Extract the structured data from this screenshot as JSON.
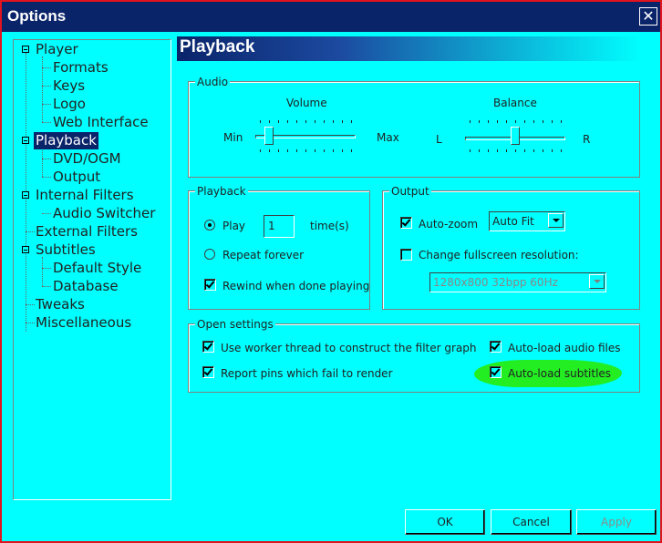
{
  "window": {
    "title": "Options",
    "close_glyph": "✕"
  },
  "tree": {
    "items": [
      {
        "label": "Player"
      },
      {
        "label": "Formats"
      },
      {
        "label": "Keys"
      },
      {
        "label": "Logo"
      },
      {
        "label": "Web Interface"
      },
      {
        "label": "Playback"
      },
      {
        "label": "DVD/OGM"
      },
      {
        "label": "Output"
      },
      {
        "label": "Internal Filters"
      },
      {
        "label": "Audio Switcher"
      },
      {
        "label": "External Filters"
      },
      {
        "label": "Subtitles"
      },
      {
        "label": "Default Style"
      },
      {
        "label": "Database"
      },
      {
        "label": "Tweaks"
      },
      {
        "label": "Miscellaneous"
      }
    ],
    "selected": "Playback"
  },
  "page": {
    "title": "Playback"
  },
  "audio": {
    "group_label": "Audio",
    "volume_label": "Volume",
    "volume_min": "Min",
    "volume_max": "Max",
    "volume_level_fraction": 0.1,
    "balance_label": "Balance",
    "balance_left": "L",
    "balance_right": "R",
    "balance_level_fraction": 0.5
  },
  "playback": {
    "group_label": "Playback",
    "play_label": "Play",
    "play_selected": true,
    "play_count": "1",
    "times_label": "time(s)",
    "repeat_label": "Repeat forever",
    "repeat_selected": false,
    "rewind_label": "Rewind when done playing",
    "rewind_checked": true
  },
  "output": {
    "group_label": "Output",
    "autozoom_label": "Auto-zoom",
    "autozoom_checked": true,
    "autozoom_value": "Auto Fit",
    "fullscreen_label": "Change fullscreen resolution:",
    "fullscreen_checked": false,
    "resolution_value": "1280x800 32bpp 60Hz"
  },
  "open_settings": {
    "group_label": "Open settings",
    "worker_thread_label": "Use worker thread to construct the filter graph",
    "report_pins_label": "Report pins which fail to render",
    "autoload_audio_label": "Auto-load audio files",
    "autoload_subs_label": "Auto-load subtitles",
    "highlight_color": "#22ee22"
  },
  "buttons": {
    "ok": "OK",
    "cancel": "Cancel",
    "apply": "Apply"
  },
  "colors": {
    "background": "#00ffff",
    "titlebar": "#0a246a",
    "selection": "#0a246a",
    "border": "#e0141e"
  }
}
